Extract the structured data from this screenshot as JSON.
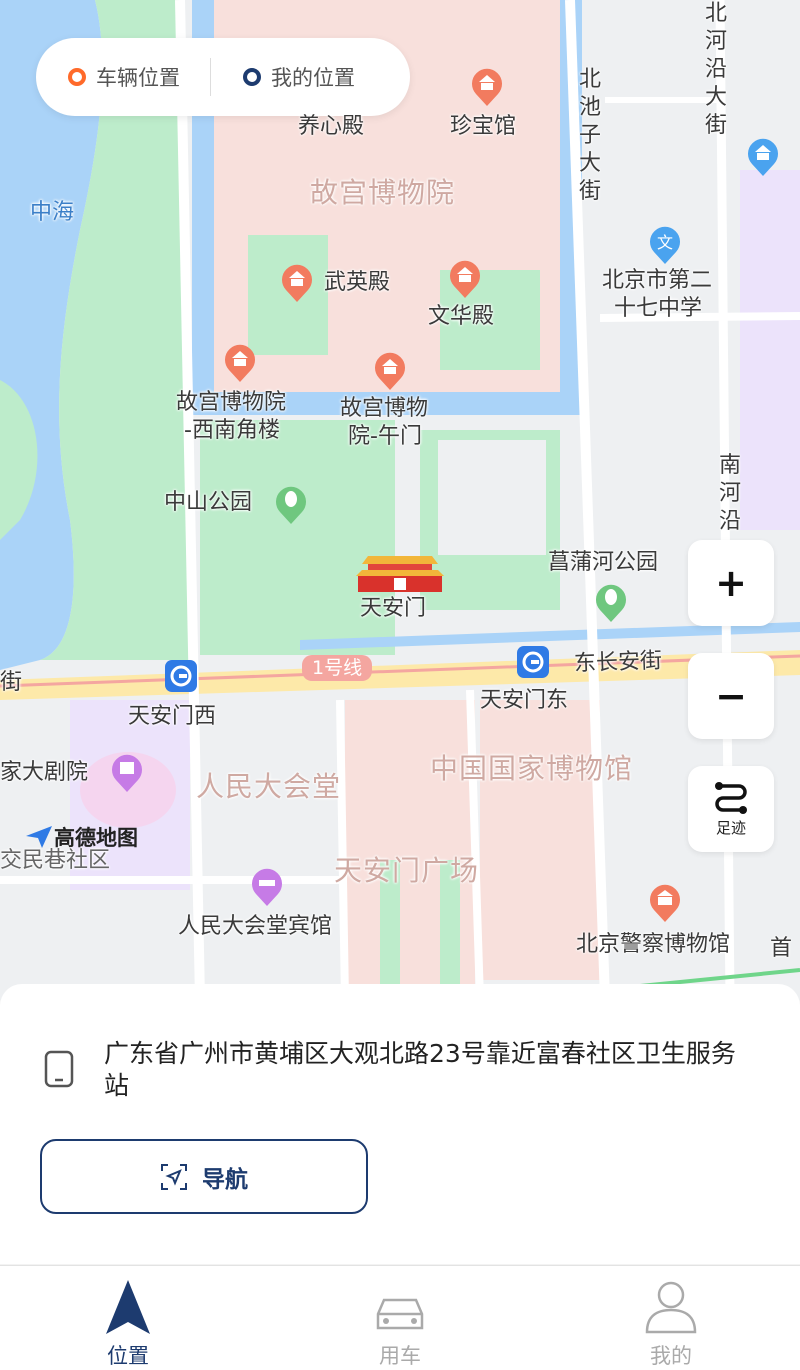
{
  "legend": {
    "vehicle": "车辆位置",
    "mine": "我的位置"
  },
  "map": {
    "labels": {
      "yangxindian": "养心殿",
      "zhenbaoguan": "珍宝馆",
      "gugong": "故宫博物院",
      "wuyingdian": "武英殿",
      "wenhuadian": "文华殿",
      "zhonghai": "中海",
      "beichizi": "北池子大街",
      "beiheyan": "北河沿大街",
      "school_1": "北京市第二",
      "school_2": "十七中学",
      "sw_corner_1": "故宫博物院",
      "sw_corner_2": "-西南角楼",
      "wumen_1": "故宫博物",
      "wumen_2": "院-午门",
      "zhongshan": "中山公园",
      "changpu": "菖蒲河公园",
      "tiananmen": "天安门",
      "nanheyan": "南河沿",
      "line1": "1号线",
      "dongchangan": "东长安街",
      "jie": "街",
      "tiananmen_west": "天安门西",
      "tiananmen_east": "天安门东",
      "theater": "家大剧院",
      "renmin_hall": "人民大会堂",
      "museum": "中国国家博物馆",
      "jiaomin": "交民巷社区",
      "square": "天安门广场",
      "hall_hotel": "人民大会堂宾馆",
      "police_museum": "北京警察博物馆",
      "shou": "首"
    },
    "brand": "高德地图"
  },
  "controls": {
    "zoom_in": "+",
    "zoom_out": "−",
    "track": "足迹"
  },
  "panel": {
    "address": "广东省广州市黄埔区大观北路23号靠近富春社区卫生服务站",
    "nav_label": "导航"
  },
  "tabs": [
    {
      "label": "位置",
      "active": true
    },
    {
      "label": "用车",
      "active": false
    },
    {
      "label": "我的",
      "active": false
    }
  ],
  "colors": {
    "accent": "#1d3b6f",
    "vehicle_ring": "#ff6a2a",
    "poi_orange": "#f27b5f",
    "poi_blue": "#4aa3ef",
    "poi_purple": "#c67be6",
    "poi_green": "#6fc77f"
  }
}
